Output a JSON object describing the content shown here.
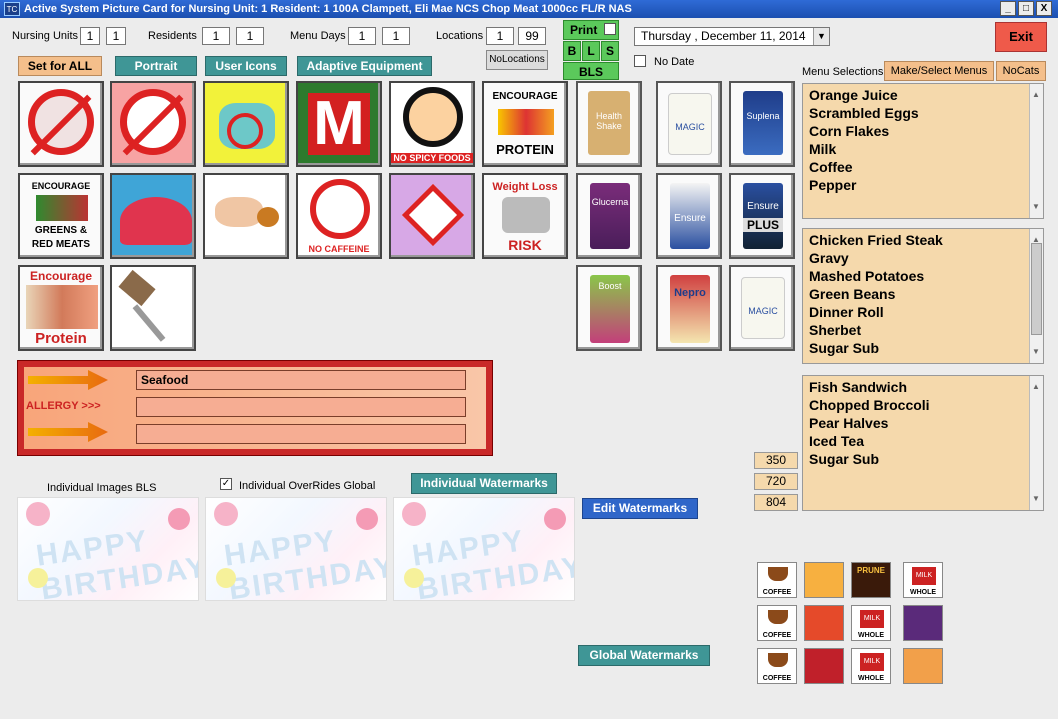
{
  "window": {
    "app_icon": "TC",
    "title": "Active System Picture Card for Nursing Unit: 1  Resident: 1  100A Clampett, Eli Mae NCS Chop Meat 1000cc FL/R NAS",
    "buttons": [
      "_",
      "□",
      "X"
    ]
  },
  "filters": {
    "nursing_units_label": "Nursing Units",
    "nursing_units_from": "1",
    "nursing_units_to": "1",
    "residents_label": "Residents",
    "residents_from": "1",
    "residents_to": "1",
    "menu_days_label": "Menu Days",
    "menu_days_from": "1",
    "menu_days_to": "1",
    "locations_label": "Locations",
    "locations_from": "1",
    "locations_to": "99",
    "nolocations_label": "NoLocations"
  },
  "print": {
    "label": "Print",
    "b": "B",
    "l": "L",
    "s": "S",
    "bls": "BLS"
  },
  "date": {
    "day": "Thursday",
    "date": ",  December 11, 2014"
  },
  "no_date_label": "No Date",
  "exit_label": "Exit",
  "toolbar": {
    "set_all": "Set for ALL",
    "portrait": "Portrait",
    "user_icons": "User Icons",
    "adaptive": "Adaptive Equipment"
  },
  "tiles": {
    "t1": "",
    "t4": "M",
    "t5": "NO SPICY FOODS",
    "t6a": "ENCOURAGE",
    "t6b": "PROTEIN",
    "t7": "Health Shake",
    "t8": "MAGIC",
    "t9": "Suplena",
    "t10a": "ENCOURAGE",
    "t10b": "GREENS  &",
    "t10c": "RED MEATS",
    "t13": "NO CAFFEINE",
    "t15a": "Weight Loss",
    "t15b": "RISK",
    "t16": "Glucerna",
    "t17": "Ensure",
    "t18a": "Ensure",
    "t18b": "PLUS",
    "t19a": "Encourage",
    "t19b": "Protein",
    "t21": "Boost",
    "t22": "Nepro",
    "t23": "MAGIC"
  },
  "allergy": {
    "label": "ALLERGY >>>",
    "items": [
      "Seafood",
      "",
      ""
    ]
  },
  "menu": {
    "selections_label": "Menu Selections",
    "make_select_label": "Make/Select Menus",
    "nocats_label": "NoCats",
    "breakfast": [
      "Orange Juice",
      "Scrambled Eggs",
      "Corn Flakes",
      "Milk",
      "Coffee",
      "Pepper"
    ],
    "lunch": [
      "Chicken Fried Steak",
      "Gravy",
      "Mashed Potatoes",
      "Green Beans",
      "Dinner Roll",
      "Sherbet",
      "Sugar Sub"
    ],
    "dinner": [
      "Fish Sandwich",
      "Chopped Broccoli",
      "Pear Halves",
      "Iced Tea",
      "Sugar Sub"
    ]
  },
  "calories": [
    "350",
    "720",
    "804"
  ],
  "watermarks": {
    "individual_images_label": "Individual Images BLS",
    "override_label": "Individual OverRides Global",
    "override_checked": "✓",
    "individual_btn": "Individual Watermarks",
    "edit_btn": "Edit Watermarks",
    "global_btn": "Global Watermarks",
    "wm_text": "HAPPY BIRTHDAY"
  },
  "mini_icons": {
    "coffee": "COFFEE",
    "prune": "PRUNE",
    "milk": "MILK",
    "whole": "WHOLE"
  }
}
